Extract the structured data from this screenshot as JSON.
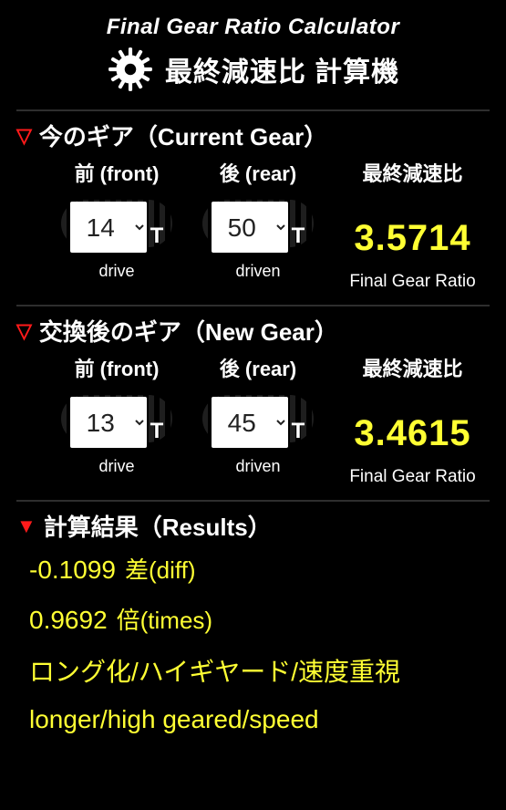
{
  "header": {
    "title_en": "Final Gear Ratio Calculator",
    "title_jp": "最終減速比 計算機"
  },
  "labels": {
    "front": "前 (front)",
    "rear": "後 (rear)",
    "ratio_jp": "最終減速比",
    "ratio_en": "Final Gear Ratio",
    "drive": "drive",
    "driven": "driven",
    "t_suffix": "T"
  },
  "current": {
    "section_title": "今のギア（Current Gear）",
    "front_value": "14",
    "rear_value": "50",
    "ratio": "3.5714"
  },
  "new": {
    "section_title": "交換後のギア（New Gear）",
    "front_value": "13",
    "rear_value": "45",
    "ratio": "3.4615"
  },
  "results": {
    "section_title": "計算結果（Results）",
    "diff_value": "-0.1099",
    "diff_unit": "差(diff)",
    "times_value": "0.9692",
    "times_unit": "倍(times)",
    "desc_jp": "ロング化/ハイギヤード/速度重視",
    "desc_en": "longer/high geared/speed"
  }
}
